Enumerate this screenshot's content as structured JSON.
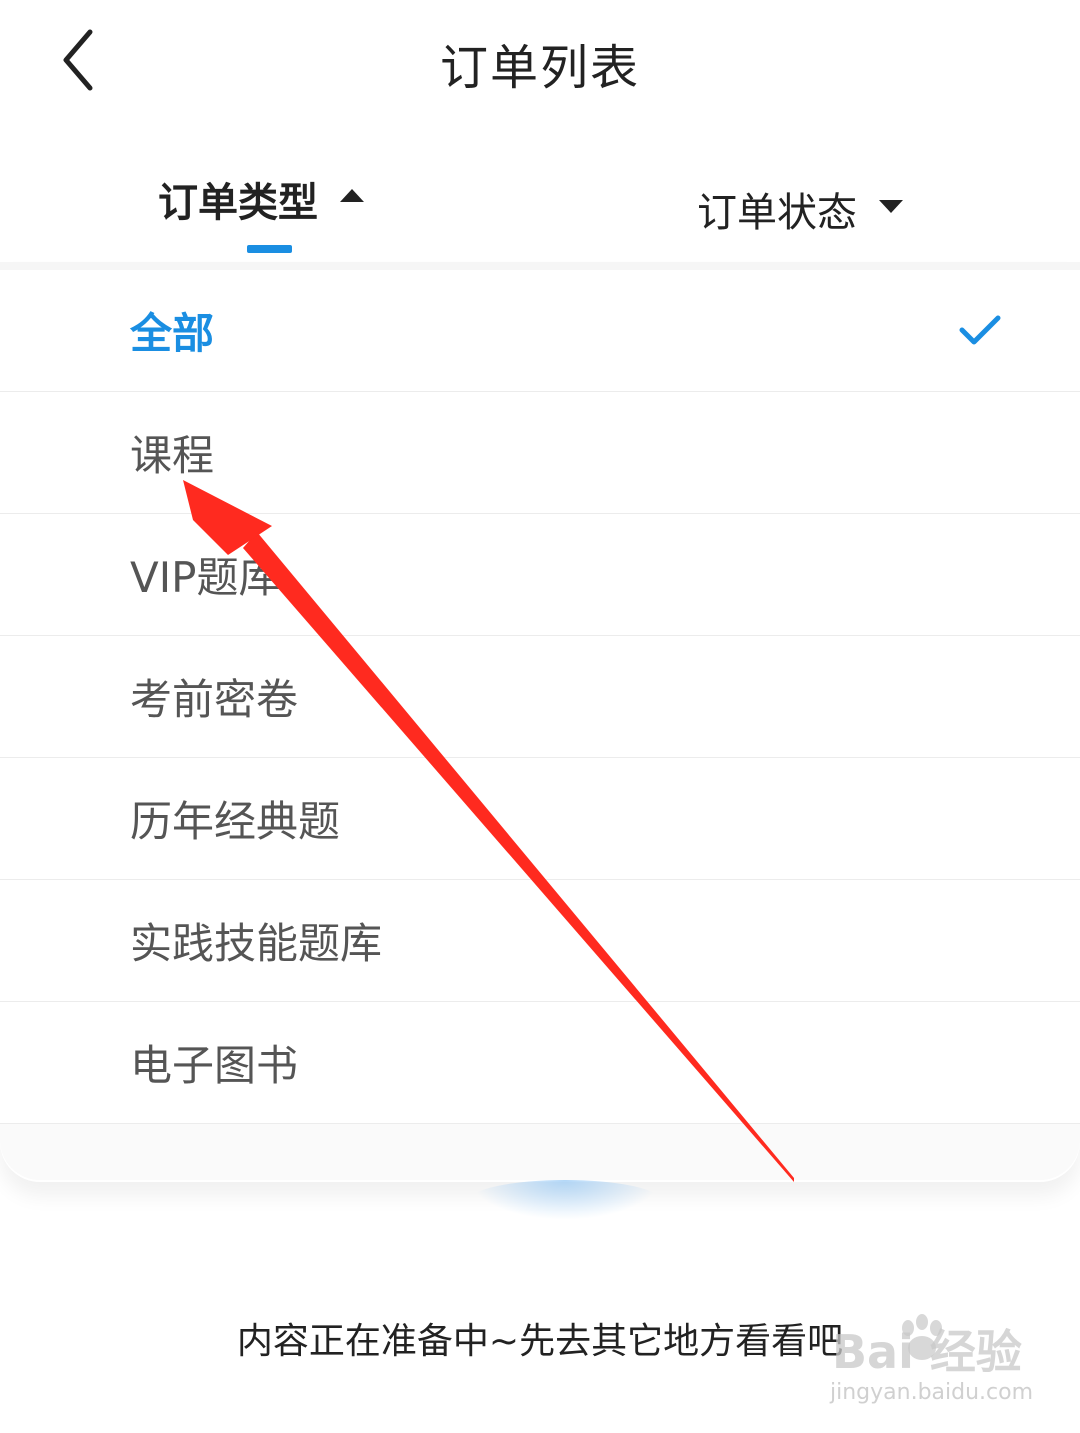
{
  "header": {
    "title": "订单列表"
  },
  "filters": {
    "type_label": "订单类型",
    "status_label": "订单状态"
  },
  "dropdown": {
    "options": [
      {
        "label": "全部",
        "selected": true
      },
      {
        "label": "课程"
      },
      {
        "label": "VIP题库"
      },
      {
        "label": "考前密卷"
      },
      {
        "label": "历年经典题"
      },
      {
        "label": "实践技能题库"
      },
      {
        "label": "电子图书"
      }
    ]
  },
  "empty_state": {
    "message": "内容正在准备中~先去其它地方看看吧"
  },
  "watermark": {
    "logo": "Bai  经验",
    "url": "jingyan.baidu.com"
  },
  "colors": {
    "accent": "#1a8ee2",
    "arrow": "#ff2a1f"
  },
  "icons": [
    "back-arrow-icon",
    "caret-up-icon",
    "caret-down-icon",
    "checkmark-icon",
    "paw-icon"
  ]
}
